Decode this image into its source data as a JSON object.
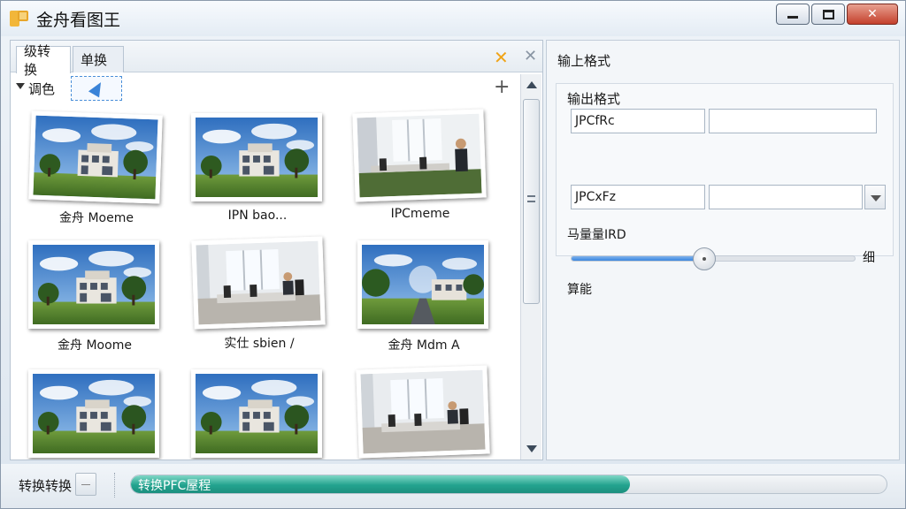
{
  "window": {
    "title": "金舟看图王",
    "controls": {
      "minimize": "minimize",
      "maximize": "maximize",
      "close": "✕"
    }
  },
  "left_panel": {
    "tabs": [
      {
        "label": "级转换",
        "active": true
      },
      {
        "label": "单换",
        "active": false
      }
    ],
    "pin_icon": "✕",
    "close_icon": "✕",
    "group_label": "调色",
    "add_icon": "+",
    "thumbnails": [
      {
        "caption": "金舟 Moeme",
        "scene": "house"
      },
      {
        "caption": "IPN bao...",
        "scene": "house"
      },
      {
        "caption": "IPCmeme",
        "scene": "office-man"
      },
      {
        "caption": "金舟 Moome",
        "scene": "house"
      },
      {
        "caption": "实仕 sbien /",
        "scene": "office"
      },
      {
        "caption": "金舟 Mdm A",
        "scene": "house-road"
      },
      {
        "caption": "",
        "scene": "house"
      },
      {
        "caption": "",
        "scene": "house"
      },
      {
        "caption": "",
        "scene": "office"
      }
    ]
  },
  "right_panel": {
    "title": "输上格式",
    "group_title": "输出格式",
    "field1_value": "JPCfRc",
    "field2_value": "",
    "dropdown_value": "JPCxFz",
    "dropdown_extra": "",
    "quality_label": "马量量IRD",
    "quality_value": 0.47,
    "slider_end_label": "细",
    "extra_label": "算能"
  },
  "status": {
    "label": "转换转换",
    "progress_text": "转换PFC屋程",
    "progress_value": 0.66
  },
  "colors": {
    "accent": "#3a86df",
    "progress": "#23a38f",
    "pin": "#f0a418"
  }
}
